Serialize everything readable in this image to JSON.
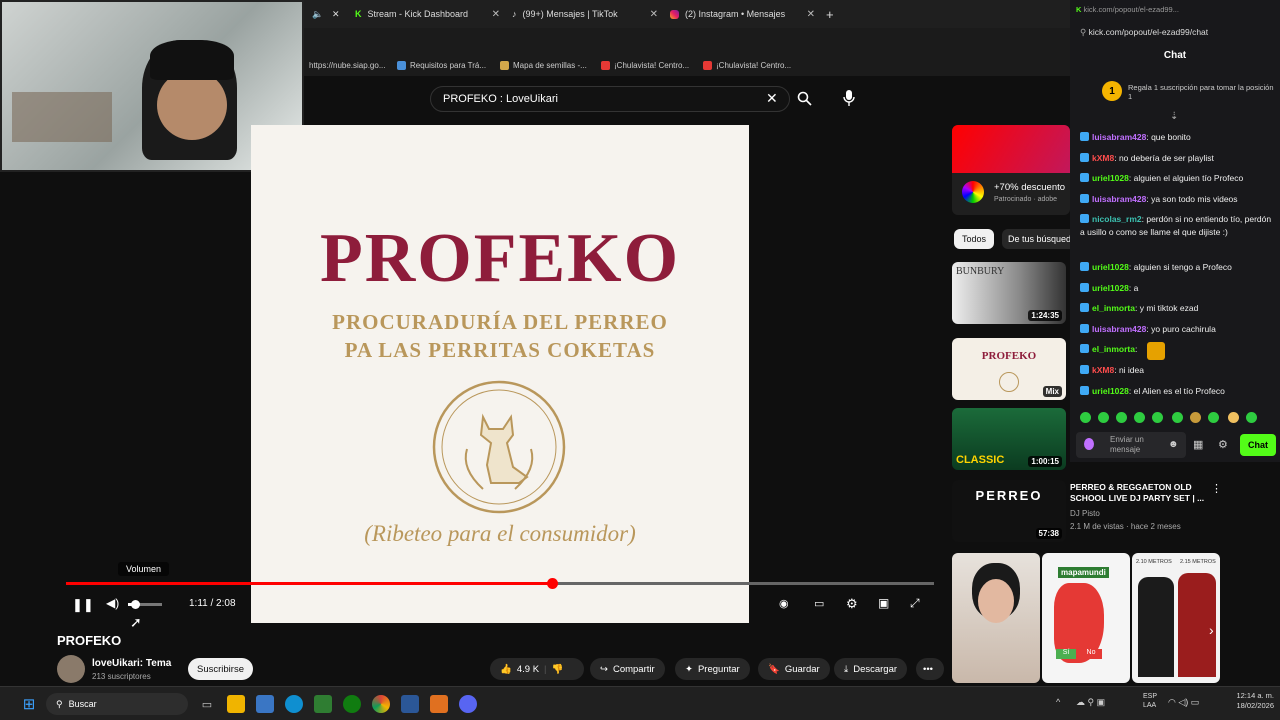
{
  "browser": {
    "tabs": [
      {
        "label": "Stream - Kick Dashboard"
      },
      {
        "label": "(99+) Mensajes | TikTok"
      },
      {
        "label": "(2) Instagram • Mensajes"
      }
    ],
    "close_glyph": "✕",
    "new_tab_glyph": "+",
    "bookmarks": [
      {
        "label": "https://nube.siap.go..."
      },
      {
        "label": "Requisitos para Trá..."
      },
      {
        "label": "Mapa de semillas -..."
      },
      {
        "label": "¡Chulavista! Centro..."
      },
      {
        "label": "¡Chulavista! Centro..."
      }
    ]
  },
  "popup": {
    "url_top": "kick.com/popout/el-ezad99...",
    "url": "kick.com/popout/el-ezad99/chat"
  },
  "youtube": {
    "search_value": "PROFEKO : LoveUikari",
    "video": {
      "headline": "PROFEKO",
      "subline1": "PROCURADURÍA DEL PERREO",
      "subline2": "PA LAS PERRITAS COKETAS",
      "tagline": "(Ribeteo para el consumidor)"
    },
    "player": {
      "tooltip": "Volumen",
      "time": "1:11 / 2:08",
      "progress_fraction": 0.56
    },
    "title": "PROFEKO",
    "channel": {
      "name": "loveUikari: Tema",
      "subs": "213 suscriptores",
      "subscribe": "Suscribirse"
    },
    "actions": {
      "likes": "4.9 K",
      "share": "Compartir",
      "ask": "Preguntar",
      "save": "Guardar",
      "download": "Descargar"
    },
    "ad": {
      "text": "+70% descuento",
      "sponsored": "Patrocinado · adobe"
    },
    "chips": [
      "Todos",
      "De tus búsqued"
    ],
    "recommended": [
      {
        "duration": "1:24:35",
        "label": "BUNBURY"
      },
      {
        "duration": "Mix",
        "label": "PROFEKO"
      },
      {
        "duration": "1:00:15",
        "label": "CLASSIC"
      },
      {
        "duration": "57:38",
        "label": "PERREO",
        "title": "PERREO & REGGAETON OLD SCHOOL LIVE DJ PARTY SET | ...",
        "channel": "DJ Pisto",
        "meta": "2.1 M de vistas · hace 2 meses"
      }
    ],
    "shorts_labels": [
      "mapamundi",
      "2.10 METROS",
      "2.15 METROS"
    ],
    "map_legend": {
      "yes": "Sí",
      "no": "No"
    }
  },
  "chat": {
    "title": "Chat",
    "gift_banner": "Regala 1 suscripción para tomar la posición 1",
    "gift_position": "1",
    "messages": [
      {
        "user": "luisabram428",
        "text": ": que bonito",
        "color": "#c070ff"
      },
      {
        "user": "kXM8",
        "text": ": no debería de ser playlist",
        "color": "#ff4d4d"
      },
      {
        "user": "uriel1028",
        "text": ": alguien el alguien tío Profeco",
        "color": "#53fc18"
      },
      {
        "user": "luisabram428",
        "text": ": ya son todo mis videos",
        "color": "#c070ff"
      },
      {
        "user": "nicolas_rm2",
        "text": ": perdón si no entiendo tío, perdón a usillo o como se llame el que dijiste :)",
        "color": "#3cc0b0"
      },
      {
        "user": "uriel1028",
        "text": ": alguien si tengo a Profeco",
        "color": "#53fc18"
      },
      {
        "user": "uriel1028",
        "text": ": a",
        "color": "#53fc18"
      },
      {
        "user": "el_inmorta",
        "text": ": y mi tiktok ezad",
        "color": "#53fc18"
      },
      {
        "user": "luisabram428",
        "text": ": yo puro cachirula",
        "color": "#c070ff"
      },
      {
        "user": "el_inmorta",
        "text": ":",
        "color": "#53fc18"
      },
      {
        "user": "kXM8",
        "text": ": ni idea",
        "color": "#ff4d4d"
      },
      {
        "user": "uriel1028",
        "text": ": el Alien es el tío Profeco",
        "color": "#53fc18"
      }
    ],
    "input_placeholder": "Enviar un mensaje",
    "send": "Chat",
    "accent": "#53fc18"
  },
  "taskbar": {
    "search": "Buscar",
    "lang": "ESP",
    "lang2": "LAA",
    "time": "12:14 a. m.",
    "date": "18/02/2026"
  }
}
